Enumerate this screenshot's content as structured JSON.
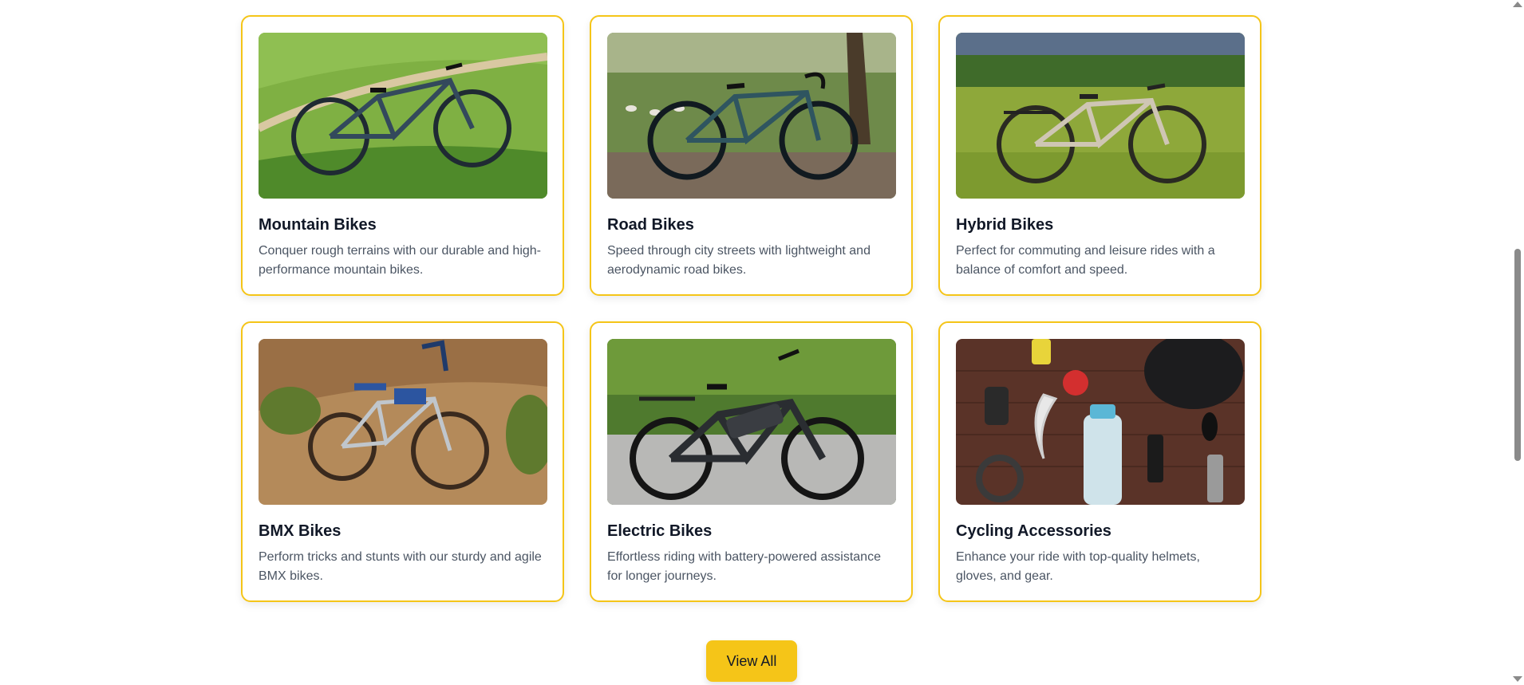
{
  "categories": [
    {
      "title": "Mountain Bikes",
      "description": "Conquer rough terrains with our durable and high-performance mountain bikes.",
      "image_icon": "mountain-bike-image"
    },
    {
      "title": "Road Bikes",
      "description": "Speed through city streets with lightweight and aerodynamic road bikes.",
      "image_icon": "road-bike-image"
    },
    {
      "title": "Hybrid Bikes",
      "description": "Perfect for commuting and leisure rides with a balance of comfort and speed.",
      "image_icon": "hybrid-bike-image"
    },
    {
      "title": "BMX Bikes",
      "description": "Perform tricks and stunts with our sturdy and agile BMX bikes.",
      "image_icon": "bmx-bike-image"
    },
    {
      "title": "Electric Bikes",
      "description": "Effortless riding with battery-powered assistance for longer journeys.",
      "image_icon": "electric-bike-image"
    },
    {
      "title": "Cycling Accessories",
      "description": "Enhance your ride with top-quality helmets, gloves, and gear.",
      "image_icon": "cycling-accessories-image"
    }
  ],
  "actions": {
    "view_all_label": "View All"
  },
  "colors": {
    "accent": "#f5c518",
    "title": "#111827",
    "body_text": "#4b5563"
  }
}
